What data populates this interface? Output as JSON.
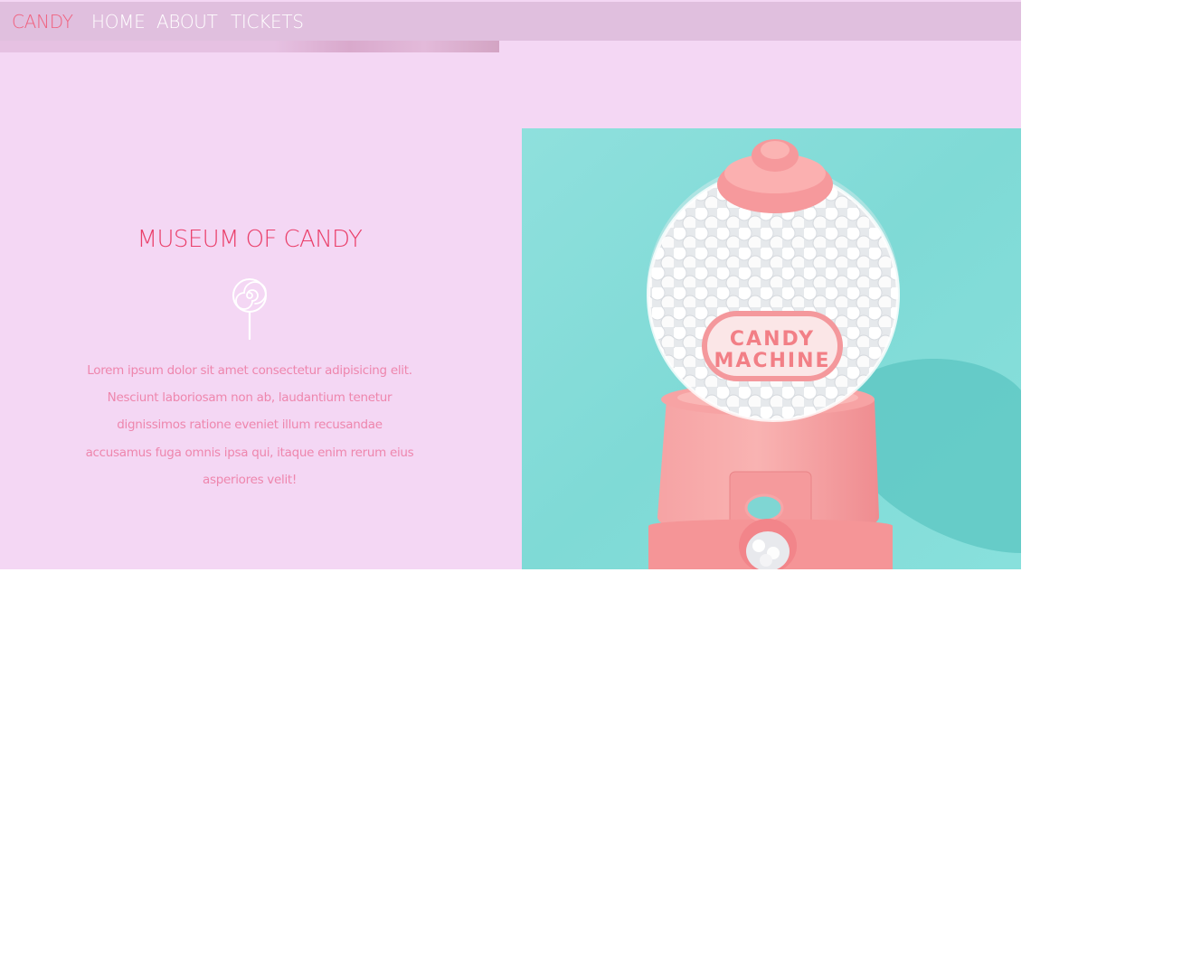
{
  "nav": {
    "brand": "CANDY",
    "links": [
      {
        "label": "HOME"
      },
      {
        "label": "ABOUT"
      },
      {
        "label": "TICKETS"
      }
    ]
  },
  "hero": {
    "title": "MUSEUM OF CANDY",
    "icon": "lollipop-icon",
    "description": "Lorem ipsum dolor sit amet consectetur adipisicing elit. Nesciunt laboriosam non ab, laudantium tenetur dignissimos ratione eveniet illum recusandae accusamus fuga omnis ipsa qui, itaque enim rerum eius asperiores velit!"
  },
  "photo": {
    "label_line1": "CANDY",
    "label_line2": "MACHINE"
  },
  "colors": {
    "page_background": "#f4d7f4",
    "navbar": "#e0bfde",
    "brand": "#f0617e",
    "title": "#ea3f6a",
    "body_text": "#ee86ad",
    "photo_background": "#7fdcd8",
    "machine_pink": "#f7989a"
  }
}
